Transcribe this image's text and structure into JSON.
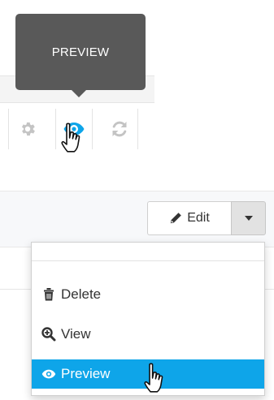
{
  "tooltip": {
    "text": "PREVIEW"
  },
  "icon_row": {
    "icons": [
      "gear-icon",
      "eye-icon",
      "refresh-icon"
    ],
    "active_color": "#0ea5e9",
    "muted_color": "#c4c4c4"
  },
  "toolbar": {
    "edit_label": "Edit",
    "edit_icon": "pencil-icon",
    "caret_icon": "caret-down-icon"
  },
  "dropdown": {
    "items": [
      {
        "label": "Delete",
        "icon": "trash-icon"
      },
      {
        "label": "View",
        "icon": "zoom-in-icon"
      },
      {
        "label": "Preview",
        "icon": "eye-icon",
        "highlighted": true
      }
    ],
    "highlight_color": "#0ea5e9"
  }
}
